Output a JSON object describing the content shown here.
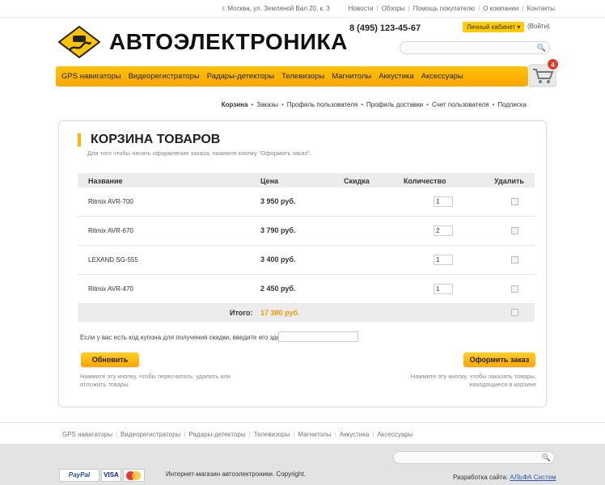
{
  "topbar": {
    "address": "г. Москва, ул. Земляной Вал 20, к. 3",
    "links": [
      "Новости",
      "Обзоры",
      "Помощь покупателю",
      "О компании",
      "Контакты"
    ]
  },
  "header": {
    "logo_text": "АВТОЭЛЕКТРОНИКА",
    "phone": "8 (495) 123-45-67",
    "cabinet_label": "Личный кабинет",
    "logout_label": "(Войти)",
    "search_placeholder": ""
  },
  "main_nav": [
    "GPS навигаторы",
    "Видеорегистраторы",
    "Радары-детекторы",
    "Телевизоры",
    "Магнитолы",
    "Аккустика",
    "Аксессуары"
  ],
  "cart": {
    "count": "4"
  },
  "sub_nav": [
    "Корзина",
    "Заказы",
    "Профиль пользователя",
    "Профиль доставки",
    "Счет пользователя",
    "Подписка"
  ],
  "basket": {
    "title": "КОРЗИНА ТОВАРОВ",
    "subtitle": "Для того чтобы начать оформление заказа, нажмите кнопку \"Оформить заказ\".",
    "columns": {
      "name": "Название",
      "price": "Цена",
      "discount": "Скидка",
      "quantity": "Количество",
      "delete": "Удалить"
    },
    "items": [
      {
        "name": "Ritmix AVR-700",
        "price": "3 950 руб.",
        "quantity": "1"
      },
      {
        "name": "Ritmix AVR-670",
        "price": "3 790 руб.",
        "quantity": "2"
      },
      {
        "name": "LEXAND SG-555",
        "price": "3 400 руб.",
        "quantity": "1"
      },
      {
        "name": "Ritmix AVR-470",
        "price": "2 450 руб.",
        "quantity": "1"
      }
    ],
    "total_label": "Итого:",
    "total_value": "17 380 руб.",
    "coupon_label": "Если у вас есть код купона для получения скидки, введите его здесь:",
    "coupon_value": "",
    "update_button": "Обновить",
    "order_button": "Оформить заказ",
    "update_hint": "Нажмите эту кнопку, чтобы пересчитать, удалить или отложить товары.",
    "order_hint": "Нажмите эту кнопку, чтобы заказать товары, находящиеся в корзине"
  },
  "footer": {
    "links": [
      "GPS навигаторы",
      "Видеорегистраторы",
      "Радары-детекторы",
      "Телевизоры",
      "Магнитолы",
      "Аккустика",
      "Аксессуары"
    ],
    "copyright": "Интернет-магазин автоэлектроники. Copyright.",
    "dev_label": "Разработка сайта:",
    "dev_link": "АЛЬФА Систем",
    "payments": {
      "paypal": "PayPal",
      "visa": "VISA"
    },
    "search_placeholder": ""
  },
  "colors": {
    "accent": "#ffb400",
    "total": "#f39a00",
    "badge": "#e23b2a",
    "link": "#2a5db0"
  }
}
